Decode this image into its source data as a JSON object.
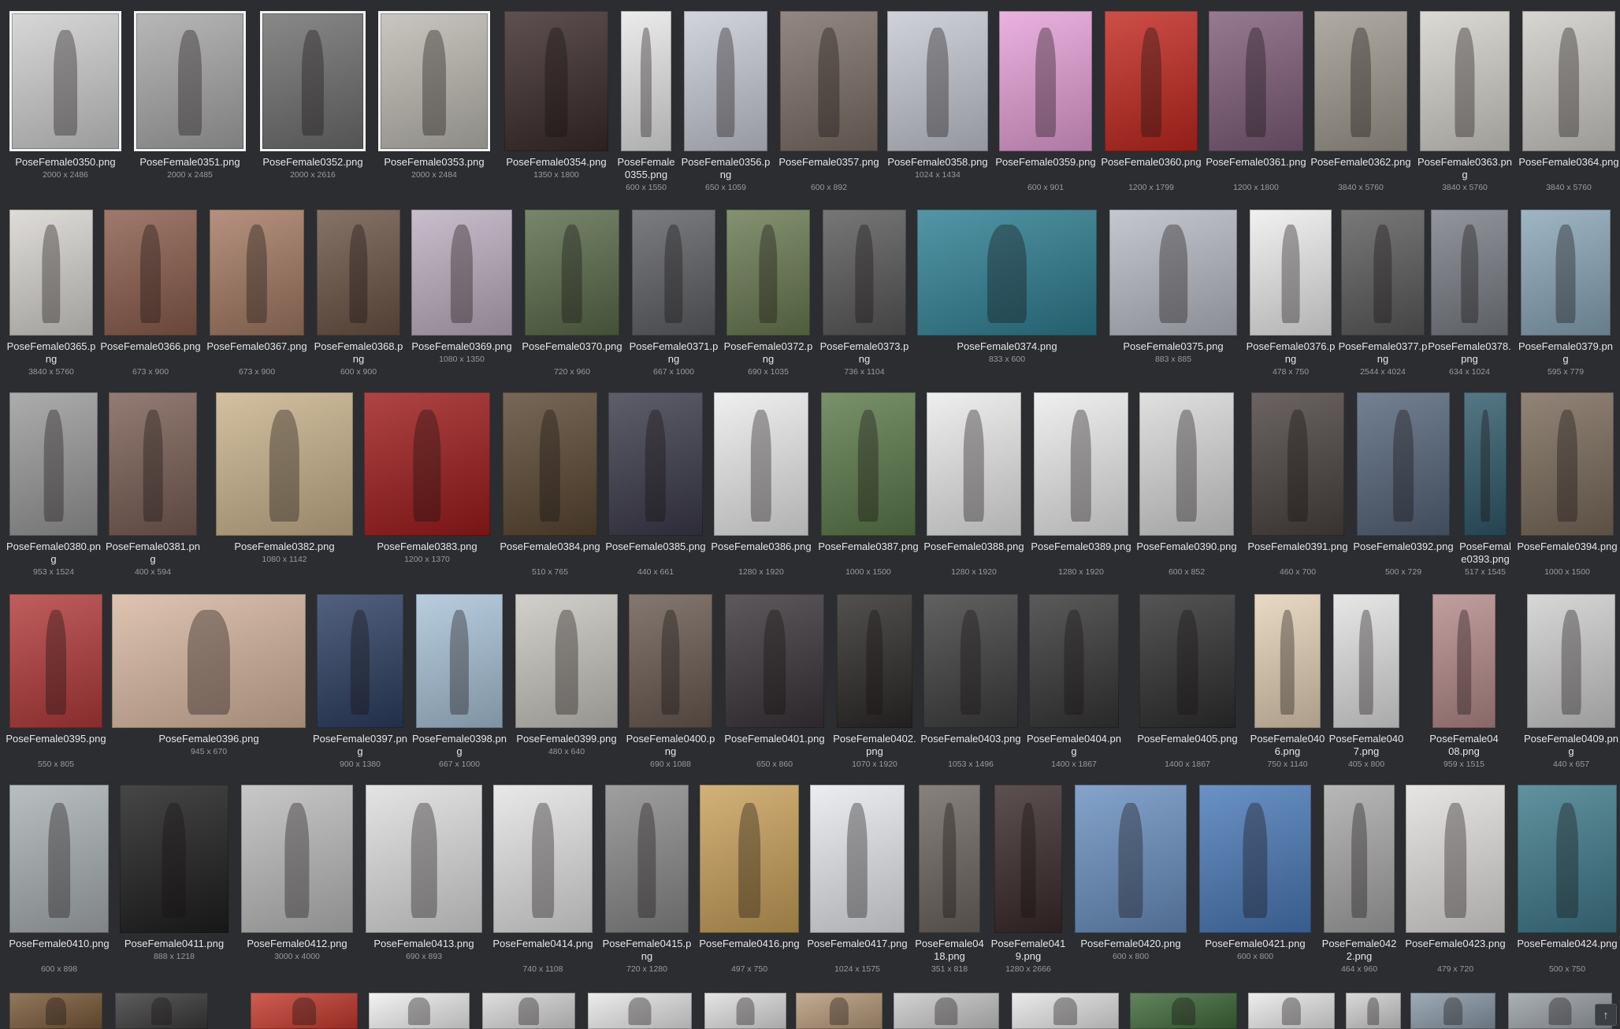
{
  "images": [
    {
      "name": "PoseFemale0350.png",
      "dims": "2000 x 2486",
      "bg": "#cfcfcf"
    },
    {
      "name": "PoseFemale0351.png",
      "dims": "2000 x 2485",
      "bg": "#a8a8a8"
    },
    {
      "name": "PoseFemale0352.png",
      "dims": "2000 x 2616",
      "bg": "#6f6f6f"
    },
    {
      "name": "PoseFemale0353.png",
      "dims": "2000 x 2484",
      "bg": "#bdbab2"
    },
    {
      "name": "PoseFemale0354.png",
      "dims": "1350 x 1800",
      "bg": "#3b2a2a"
    },
    {
      "name": "PoseFemale0355.png",
      "dims": "600 x 1550",
      "bg": "#e8e8e8"
    },
    {
      "name": "PoseFemale0356.png",
      "dims": "650 x 1059",
      "bg": "#c9ccd6"
    },
    {
      "name": "PoseFemale0357.png",
      "dims": "600 x 892",
      "bg": "#7c6e66"
    },
    {
      "name": "PoseFemale0358.png",
      "dims": "1024 x 1434",
      "bg": "#c6c9d2"
    },
    {
      "name": "PoseFemale0359.png",
      "dims": "600 x 901",
      "bg": "#e7a1d8"
    },
    {
      "name": "PoseFemale0360.png",
      "dims": "1200 x 1799",
      "bg": "#c2281f"
    },
    {
      "name": "PoseFemale0361.png",
      "dims": "1200 x 1800",
      "bg": "#7f5d78"
    },
    {
      "name": "PoseFemale0362.png",
      "dims": "3840 x 5760",
      "bg": "#9f9a90"
    },
    {
      "name": "PoseFemale0363.png",
      "dims": "3840 x 5760",
      "bg": "#d4d2cc"
    },
    {
      "name": "PoseFemale0364.png",
      "dims": "3840 x 5760",
      "bg": "#cfcdc8"
    },
    {
      "name": "PoseFemale0365.png",
      "dims": "3840 x 5760",
      "bg": "#d8d5d0"
    },
    {
      "name": "PoseFemale0366.png",
      "dims": "673 x 900",
      "bg": "#8a5d4c"
    },
    {
      "name": "PoseFemale0367.png",
      "dims": "673 x 900",
      "bg": "#a47a62"
    },
    {
      "name": "PoseFemale0368.png",
      "dims": "600 x 900",
      "bg": "#6c5446"
    },
    {
      "name": "PoseFemale0369.png",
      "dims": "1080 x 1350",
      "bg": "#bdb0c0"
    },
    {
      "name": "PoseFemale0370.png",
      "dims": "720 x 960",
      "bg": "#5a6b4a"
    },
    {
      "name": "PoseFemale0371.png",
      "dims": "667 x 1000",
      "bg": "#5e6064"
    },
    {
      "name": "PoseFemale0372.png",
      "dims": "690 x 1035",
      "bg": "#6a7a52"
    },
    {
      "name": "PoseFemale0373.png",
      "dims": "736 x 1104",
      "bg": "#595959"
    },
    {
      "name": "PoseFemale0374.png",
      "dims": "833 x 600",
      "bg": "#2e7f92"
    },
    {
      "name": "PoseFemale0375.png",
      "dims": "883 x 885",
      "bg": "#b8bcc4"
    },
    {
      "name": "PoseFemale0376.png",
      "dims": "478 x 750",
      "bg": "#eeeeee"
    },
    {
      "name": "PoseFemale0377.png",
      "dims": "2544 x 4024",
      "bg": "#5b5b5b"
    },
    {
      "name": "PoseFemale0378.png",
      "dims": "634 x 1024",
      "bg": "#7a7f86"
    },
    {
      "name": "PoseFemale0379.png",
      "dims": "595 x 779",
      "bg": "#8aa6b8"
    },
    {
      "name": "PoseFemale0380.png",
      "dims": "953 x 1524",
      "bg": "#9a9a9a"
    },
    {
      "name": "PoseFemale0381.png",
      "dims": "400 x 594",
      "bg": "#7a5f55"
    },
    {
      "name": "PoseFemale0382.png",
      "dims": "1080 x 1142",
      "bg": "#c9b38c"
    },
    {
      "name": "PoseFemale0383.png",
      "dims": "1200 x 1370",
      "bg": "#9e1b1b"
    },
    {
      "name": "PoseFemale0384.png",
      "dims": "510 x 765",
      "bg": "#5a4732"
    },
    {
      "name": "PoseFemale0385.png",
      "dims": "440 x 661",
      "bg": "#3b3a4a"
    },
    {
      "name": "PoseFemale0386.png",
      "dims": "1280 x 1920",
      "bg": "#ececec"
    },
    {
      "name": "PoseFemale0387.png",
      "dims": "1000 x 1500",
      "bg": "#5b7a4a"
    },
    {
      "name": "PoseFemale0388.png",
      "dims": "1280 x 1920",
      "bg": "#ebebeb"
    },
    {
      "name": "PoseFemale0389.png",
      "dims": "1280 x 1920",
      "bg": "#ececec"
    },
    {
      "name": "PoseFemale0390.png",
      "dims": "600 x 852",
      "bg": "#d9d9d9"
    },
    {
      "name": "PoseFemale0391.png",
      "dims": "460 x 700",
      "bg": "#4a4240"
    },
    {
      "name": "PoseFemale0392.png",
      "dims": "500 x 729",
      "bg": "#55657a"
    },
    {
      "name": "PoseFemale0393.png",
      "dims": "517 x 1545",
      "bg": "#2f5a6a"
    },
    {
      "name": "PoseFemale0394.png",
      "dims": "1000 x 1500",
      "bg": "#7a6a5a"
    },
    {
      "name": "PoseFemale0395.png",
      "dims": "550 x 805",
      "bg": "#b33a3a"
    },
    {
      "name": "PoseFemale0396.png",
      "dims": "945 x 670",
      "bg": "#d7b7a0"
    },
    {
      "name": "PoseFemale0397.png",
      "dims": "900 x 1380",
      "bg": "#2c3e62"
    },
    {
      "name": "PoseFemale0398.png",
      "dims": "667 x 1000",
      "bg": "#a9c3d8"
    },
    {
      "name": "PoseFemale0399.png",
      "dims": "480 x 640",
      "bg": "#c9c6bf"
    },
    {
      "name": "PoseFemale0400.png",
      "dims": "690 x 1088",
      "bg": "#6a5a50"
    },
    {
      "name": "PoseFemale0401.png",
      "dims": "650 x 860",
      "bg": "#3a3438"
    },
    {
      "name": "PoseFemale0402.png",
      "dims": "1070 x 1920",
      "bg": "#2c2a28"
    },
    {
      "name": "PoseFemale0403.png",
      "dims": "1053 x 1496",
      "bg": "#3e3e3e"
    },
    {
      "name": "PoseFemale0404.png",
      "dims": "1400 x 1867",
      "bg": "#363636"
    },
    {
      "name": "PoseFemale0405.png",
      "dims": "1400 x 1867",
      "bg": "#2f2f2f"
    },
    {
      "name": "PoseFemale0406.png",
      "dims": "750 x 1140",
      "bg": "#e5d2b8"
    },
    {
      "name": "PoseFemale0407.png",
      "dims": "405 x 800",
      "bg": "#e2e2e2"
    },
    {
      "name": "PoseFemale0408.png",
      "dims": "959 x 1515",
      "bg": "#b58a8a"
    },
    {
      "name": "PoseFemale0409.png",
      "dims": "440 x 657",
      "bg": "#cfcfcf"
    },
    {
      "name": "PoseFemale0410.png",
      "dims": "600 x 898",
      "bg": "#aab0b4"
    },
    {
      "name": "PoseFemale0411.png",
      "dims": "888 x 1218",
      "bg": "#1e1e1e"
    },
    {
      "name": "PoseFemale0412.png",
      "dims": "3000 x 4000",
      "bg": "#bcbcbc"
    },
    {
      "name": "PoseFemale0413.png",
      "dims": "690 x 893",
      "bg": "#dedede"
    },
    {
      "name": "PoseFemale0414.png",
      "dims": "740 x 1108",
      "bg": "#e4e4e4"
    },
    {
      "name": "PoseFemale0415.png",
      "dims": "720 x 1280",
      "bg": "#8a8a8a"
    },
    {
      "name": "PoseFemale0416.png",
      "dims": "497 x 750",
      "bg": "#c9a15a"
    },
    {
      "name": "PoseFemale0417.png",
      "dims": "1024 x 1575",
      "bg": "#e7eaee"
    },
    {
      "name": "PoseFemale0418.png",
      "dims": "351 x 818",
      "bg": "#6c6660"
    },
    {
      "name": "PoseFemale0419.png",
      "dims": "1280 x 2666",
      "bg": "#3a2a2a"
    },
    {
      "name": "PoseFemale0420.png",
      "dims": "600 x 800",
      "bg": "#6a90c0"
    },
    {
      "name": "PoseFemale0421.png",
      "dims": "600 x 800",
      "bg": "#4a7ab8"
    },
    {
      "name": "PoseFemale0422.png",
      "dims": "464 x 960",
      "bg": "#a8a8a8"
    },
    {
      "name": "PoseFemale0423.png",
      "dims": "479 x 720",
      "bg": "#e2e0de"
    },
    {
      "name": "PoseFemale0424.png",
      "dims": "500 x 750",
      "bg": "#3f7a8a"
    },
    {
      "name": "",
      "dims": "",
      "bg": "#7a5a3a"
    },
    {
      "name": "",
      "dims": "",
      "bg": "#3a3a3a"
    },
    {
      "name": "",
      "dims": "",
      "bg": "#c53a2e"
    },
    {
      "name": "",
      "dims": "",
      "bg": "#f0f0f0"
    },
    {
      "name": "",
      "dims": "",
      "bg": "#d8d8d8"
    },
    {
      "name": "",
      "dims": "",
      "bg": "#e8e8e8"
    },
    {
      "name": "",
      "dims": "",
      "bg": "#e0e0e0"
    },
    {
      "name": "",
      "dims": "",
      "bg": "#b89a7a"
    },
    {
      "name": "",
      "dims": "",
      "bg": "#cacaca"
    },
    {
      "name": "",
      "dims": "",
      "bg": "#e6e6e6"
    },
    {
      "name": "",
      "dims": "",
      "bg": "#3f6a3a"
    },
    {
      "name": "",
      "dims": "",
      "bg": "#eaeaea"
    },
    {
      "name": "",
      "dims": "",
      "bg": "#d2d2d2"
    },
    {
      "name": "",
      "dims": "",
      "bg": "#8a9aa8"
    },
    {
      "name": "",
      "dims": "",
      "bg": "#9aa0a6"
    }
  ],
  "scroll_top": {
    "glyph": "↑",
    "icon": "arrow-up-icon"
  }
}
